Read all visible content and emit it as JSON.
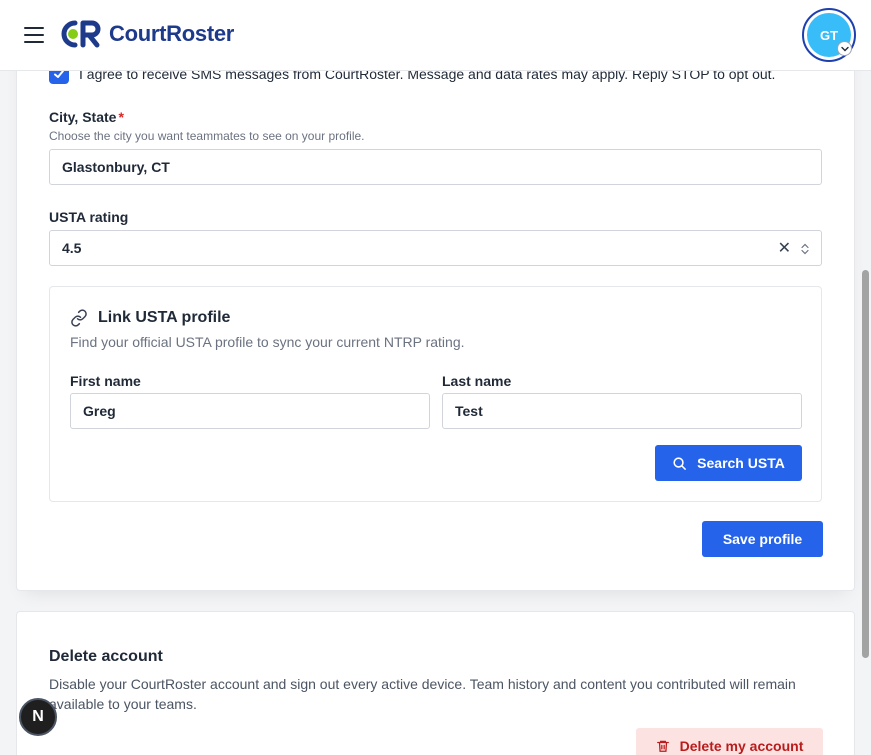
{
  "header": {
    "brand": "CourtRoster",
    "avatar_initials": "GT"
  },
  "profile": {
    "sms_consent": "I agree to receive SMS messages from CourtRoster. Message and data rates may apply. Reply STOP to opt out.",
    "sms_checked": true,
    "city_label": "City, State",
    "city_required_mark": "*",
    "city_help": "Choose the city you want teammates to see on your profile.",
    "city_value": "Glastonbury, CT",
    "usta_label": "USTA rating",
    "usta_value": "4.5",
    "link_usta": {
      "title": "Link USTA profile",
      "description": "Find your official USTA profile to sync your current NTRP rating.",
      "first_name_label": "First name",
      "first_name_value": "Greg",
      "last_name_label": "Last name",
      "last_name_value": "Test",
      "search_button": "Search USTA"
    },
    "save_button": "Save profile"
  },
  "delete_account": {
    "title": "Delete account",
    "description": "Disable your CourtRoster account and sign out every active device. Team history and content you contributed will remain available to your teams.",
    "button": "Delete my account"
  },
  "dev_badge": "N",
  "colors": {
    "primary": "#2563eb",
    "brand_navy": "#1e3a8a",
    "avatar_bg": "#38bdf8",
    "danger_text": "#b91c1c",
    "danger_bg": "#fde2e2",
    "required": "#dc2626"
  }
}
